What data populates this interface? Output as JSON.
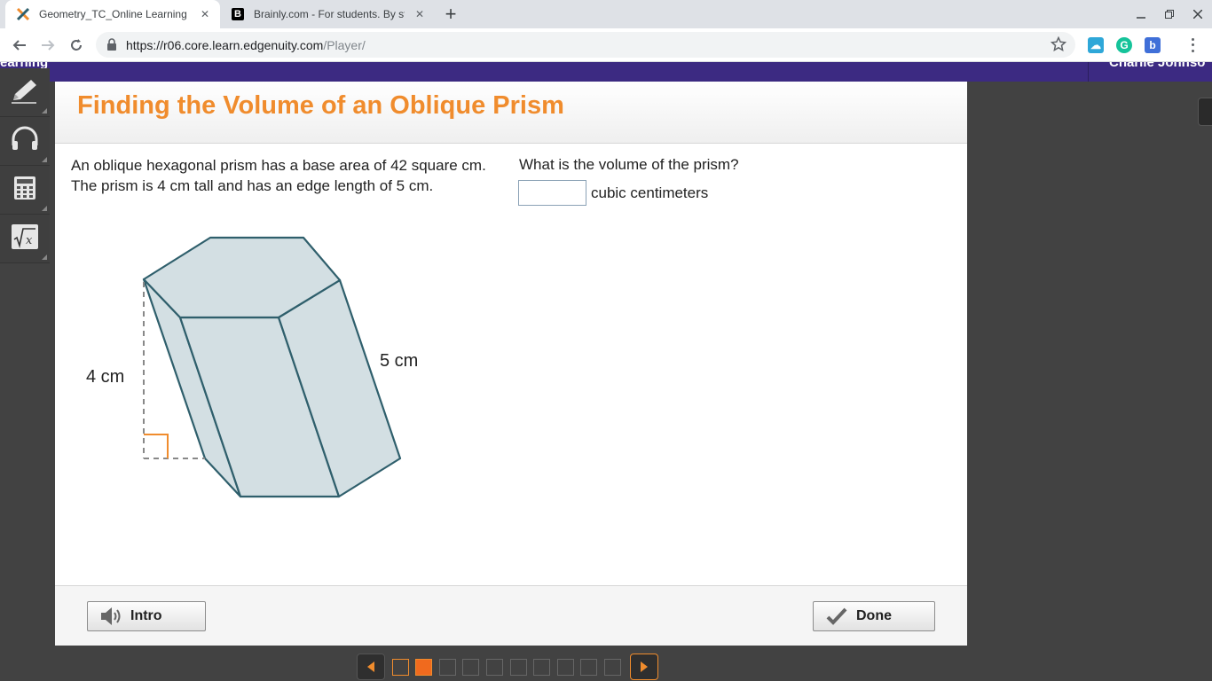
{
  "browser": {
    "tabs": [
      {
        "title": "Geometry_TC_Online Learning - E",
        "favicon": "edgenuity-x-icon",
        "active": true
      },
      {
        "title": "Brainly.com - For students. By st",
        "favicon": "brainly-b-icon",
        "active": false
      }
    ],
    "url_host": "https://r06.core.learn.edgenuity.com",
    "url_path": "/Player/",
    "extensions": [
      "cloud-ext-icon",
      "grammarly-icon",
      "brainly-ext-icon"
    ]
  },
  "topbar": {
    "left_text": "earning",
    "right_text": "Charlie Johnso"
  },
  "tools": [
    "pencil-icon",
    "headphones-icon",
    "calculator-icon",
    "formula-icon"
  ],
  "lesson": {
    "title": "Finding the Volume of an Oblique Prism",
    "problem_text": "An oblique hexagonal prism has a base area of 42 square cm. The prism is 4 cm tall and has an edge length of 5 cm.",
    "question": "What is the volume of the prism?",
    "answer_value": "",
    "unit": "cubic centimeters",
    "figure": {
      "height_label": "4 cm",
      "edge_label": "5 cm"
    }
  },
  "footer": {
    "intro_label": "Intro",
    "done_label": "Done"
  },
  "pager": {
    "total": 10,
    "current": 2,
    "visited": [
      1
    ]
  },
  "colors": {
    "title_orange": "#f08c2d",
    "topbar_purple": "#3c2a82",
    "prism_fill": "#d3dfe3",
    "prism_stroke": "#2f5f6c",
    "right_angle": "#f08c2d"
  }
}
